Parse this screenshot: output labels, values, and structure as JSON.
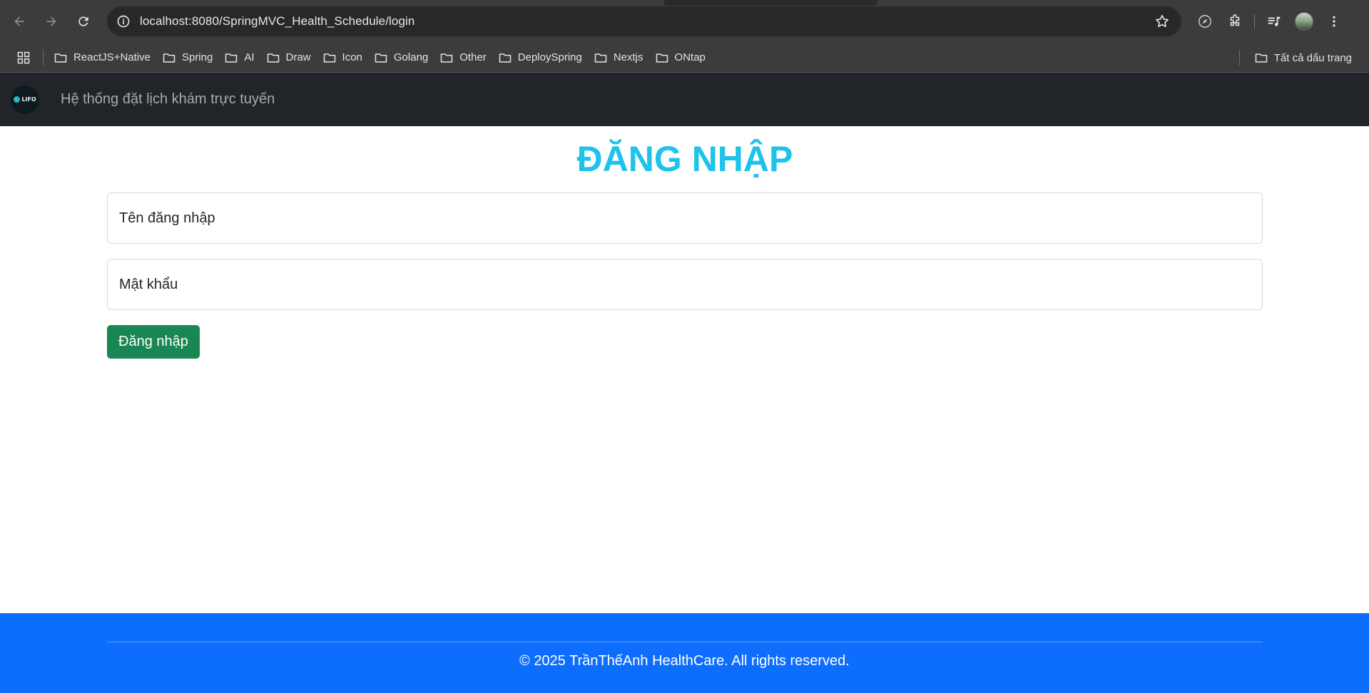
{
  "browser": {
    "url": "localhost:8080/SpringMVC_Health_Schedule/login",
    "bookmarks": [
      {
        "label": "ReactJS+Native"
      },
      {
        "label": "Spring"
      },
      {
        "label": "AI"
      },
      {
        "label": "Draw"
      },
      {
        "label": "Icon"
      },
      {
        "label": "Golang"
      },
      {
        "label": "Other"
      },
      {
        "label": "DeploySpring"
      },
      {
        "label": "Nextjs"
      },
      {
        "label": "ONtap"
      }
    ],
    "all_bookmarks_label": "Tất cả dấu trang",
    "icons": [
      "back-icon",
      "forward-icon",
      "reload-icon",
      "site-info-icon",
      "star-icon",
      "compass-icon",
      "extensions-icon",
      "media-icon",
      "profile-avatar",
      "menu-icon",
      "apps-icon",
      "folder-icon"
    ]
  },
  "navbar": {
    "logo_text": "LIFO",
    "brand": "Hệ thống đặt lịch khám trực tuyến"
  },
  "login": {
    "title": "ĐĂNG NHẬP",
    "username_placeholder": "Tên đăng nhập",
    "password_placeholder": "Mật khẩu",
    "submit_label": "Đăng nhập"
  },
  "footer": {
    "text": "© 2025 TrầnThếAnh HealthCare. All rights reserved."
  },
  "colors": {
    "title": "#1ec2ea",
    "navbar_bg": "#212529",
    "button_bg": "#198754",
    "footer_bg": "#0d6efd"
  }
}
